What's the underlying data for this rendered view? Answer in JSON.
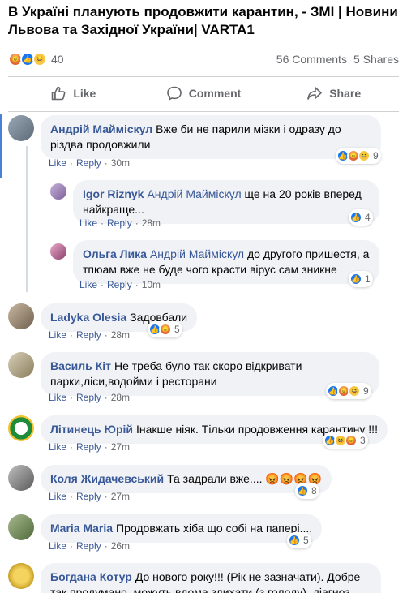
{
  "post": {
    "title": "В Україні планують продовжити карантин, - ЗМІ | Новини Львова та Західної України| VARTA1",
    "reaction_count": "40",
    "comments": "56 Comments",
    "shares": "5 Shares",
    "like_label": "Like",
    "comment_label": "Comment",
    "share_label": "Share"
  },
  "comments": [
    {
      "name": "Андрій Маймiскул",
      "text": "Вже би не парили мізки і одразу до різдва продовжили",
      "like": "Like",
      "reply": "Reply",
      "time": "30m",
      "reactions": "9"
    },
    {
      "name": "Igor Riznyk",
      "mention": "Андрій Маймiскул",
      "text": "ще на 20 років вперед найкраще...",
      "like": "Like",
      "reply": "Reply",
      "time": "28m",
      "reactions": "4"
    },
    {
      "name": "Ольга Лика",
      "mention": "Андрій Маймiскул",
      "text": "до другого пришестя, а тпюам вже не буде чого красти вірус сам зникне",
      "like": "Like",
      "reply": "Reply",
      "time": "10m",
      "reactions": "1"
    },
    {
      "name": "Ladyka Olesia",
      "text": "Задовбали",
      "like": "Like",
      "reply": "Reply",
      "time": "28m",
      "reactions": "5"
    },
    {
      "name": "Василь Кіт",
      "text": "Не треба було так скоро відкривати парки,ліси,водойми і ресторани",
      "like": "Like",
      "reply": "Reply",
      "time": "28m",
      "reactions": "9"
    },
    {
      "name": "Літинець Юрій",
      "text": "Інакше ніяк. Тільки продовження карантину !!!",
      "like": "Like",
      "reply": "Reply",
      "time": "27m",
      "reactions": "3"
    },
    {
      "name": "Коля Жидачевський",
      "text": "Та задрали вже....",
      "like": "Like",
      "reply": "Reply",
      "time": "27m",
      "reactions": "8"
    },
    {
      "name": "Maria Maria",
      "text": "Продовжать хіба що собі на папері....",
      "like": "Like",
      "reply": "Reply",
      "time": "26m",
      "reactions": "5"
    },
    {
      "name": "Богдана Котур",
      "text": "До нового року!!! (Рік не зазначати). Добре так продумано, можуть вдома здихати (з голоду), діагноз"
    }
  ]
}
